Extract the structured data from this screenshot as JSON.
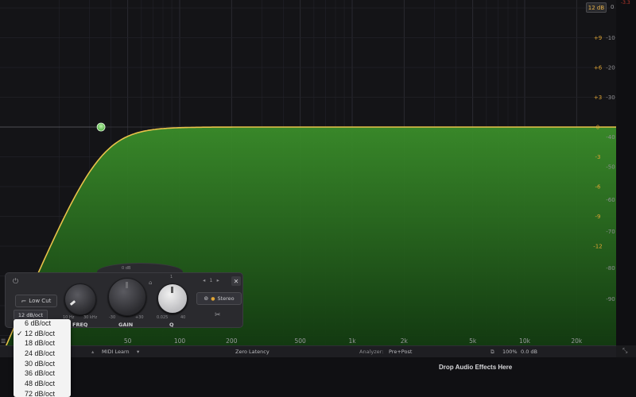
{
  "display": {
    "range_label": "12 dB",
    "zero_top": "0",
    "meter_overload": "-3.3"
  },
  "axis": {
    "gain_labels": [
      {
        "label": "+9",
        "db": 9
      },
      {
        "label": "+6",
        "db": 6
      },
      {
        "label": "+3",
        "db": 3
      },
      {
        "label": "0",
        "db": 0
      },
      {
        "label": "-3",
        "db": -3
      },
      {
        "label": "-6",
        "db": -6
      },
      {
        "label": "-9",
        "db": -9
      },
      {
        "label": "-12",
        "db": -12
      }
    ],
    "db_labels": [
      {
        "label": "-10",
        "db": 9
      },
      {
        "label": "-20",
        "db": 6
      },
      {
        "label": "-30",
        "db": 3
      },
      {
        "label": "-40",
        "db": -1
      },
      {
        "label": "-50",
        "db": -4
      },
      {
        "label": "-60",
        "db": -7.3
      },
      {
        "label": "-70",
        "db": -10.5
      },
      {
        "label": "-80",
        "db": -14.2
      },
      {
        "label": "-90",
        "db": -17.3
      }
    ],
    "freq_labels": [
      {
        "label": "50",
        "hz": 50
      },
      {
        "label": "100",
        "hz": 100
      },
      {
        "label": "200",
        "hz": 200
      },
      {
        "label": "500",
        "hz": 500
      },
      {
        "label": "1k",
        "hz": 1000
      },
      {
        "label": "2k",
        "hz": 2000
      },
      {
        "label": "5k",
        "hz": 5000
      },
      {
        "label": "10k",
        "hz": 10000
      },
      {
        "label": "20k",
        "hz": 20000
      }
    ]
  },
  "band": {
    "type_label": "Low Cut",
    "slope_label": "12 dB/oct",
    "freq_hz": 35,
    "gain_db": 0,
    "knobs": {
      "freq": {
        "label": "FREQ",
        "min": "10 Hz",
        "max": "30 kHz"
      },
      "gain": {
        "label": "GAIN",
        "min": "-30",
        "max": "+30",
        "top": "0 dB"
      },
      "q": {
        "label": "Q",
        "min": "0.025",
        "max": "40",
        "top": "1"
      }
    },
    "band_index": "1",
    "stereo_label": "Stereo"
  },
  "slope_options": {
    "items": [
      "6 dB/oct",
      "12 dB/oct",
      "18 dB/oct",
      "24 dB/oct",
      "30 dB/oct",
      "36 dB/oct",
      "48 dB/oct",
      "72 dB/oct"
    ],
    "selected_index": 1
  },
  "bottom_bar": {
    "midi_learn": "MIDI Learn",
    "latency": "Zero Latency",
    "analyzer_label": "Analyzer:",
    "analyzer_value": "Pre+Post",
    "zoom": "100%",
    "output_gain": "0.0 dB"
  },
  "drop_area": {
    "text": "Drop Audio Effects Here"
  },
  "colors": {
    "curve": "#e8c24a",
    "fill": "#2f7a22",
    "node": "#7ad36a",
    "gain_text": "#e0a534"
  }
}
